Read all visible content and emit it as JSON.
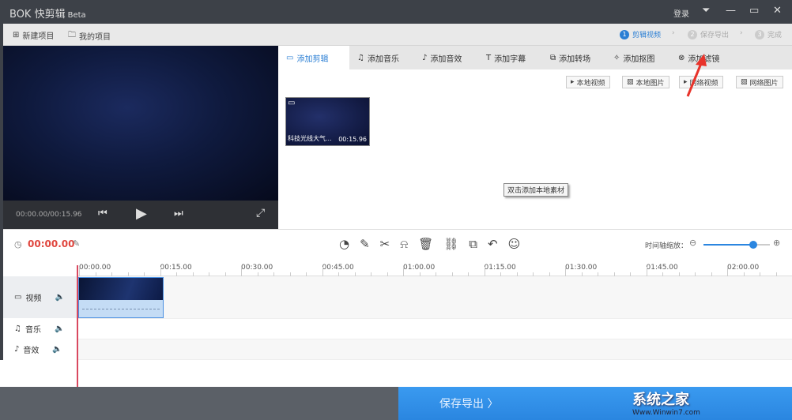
{
  "app": {
    "logo": "BOK",
    "title": "快剪辑",
    "edition": "Beta"
  },
  "window": {
    "login": "登录",
    "menu_icon": "menu-down-icon",
    "minimize_icon": "minimize-icon",
    "maximize_icon": "maximize-icon",
    "close_icon": "close-icon"
  },
  "toolbar": {
    "new_project": "新建项目",
    "my_projects": "我的项目"
  },
  "steps": [
    {
      "num": "1",
      "label": "剪辑视频",
      "active": true
    },
    {
      "num": "2",
      "label": "保存导出"
    },
    {
      "num": "3",
      "label": "完成"
    }
  ],
  "player": {
    "time": "00:00.00/00:15.96"
  },
  "tabs": [
    {
      "label": "添加剪辑",
      "icon": "video-icon",
      "active": true
    },
    {
      "label": "添加音乐",
      "icon": "music-icon"
    },
    {
      "label": "添加音效",
      "icon": "sound-effect-icon"
    },
    {
      "label": "添加字幕",
      "icon": "text-icon"
    },
    {
      "label": "添加转场",
      "icon": "transition-icon"
    },
    {
      "label": "添加抠图",
      "icon": "cutout-icon"
    },
    {
      "label": "添加滤镜",
      "icon": "filter-icon"
    }
  ],
  "sources": [
    "本地视频",
    "本地图片",
    "网络视频",
    "网络图片"
  ],
  "media": [
    {
      "name": "科技光线大气...",
      "duration": "00:15.96"
    }
  ],
  "tooltip": "双击添加本地素材",
  "timeline": {
    "current": "00:00.00",
    "zoom_label": "时间轴缩放：",
    "zoom_level": 0.75,
    "ticks": [
      "00:00.00",
      "00:15.00",
      "00:30.00",
      "00:45.00",
      "01:00.00",
      "01:15.00",
      "01:30.00",
      "01:45.00",
      "02:00.00"
    ],
    "tracks": [
      {
        "label": "视频",
        "icon": "video-icon"
      },
      {
        "label": "音乐",
        "icon": "music-icon"
      },
      {
        "label": "音效",
        "icon": "sound-effect-icon"
      }
    ]
  },
  "export": "保存导出 〉",
  "watermark": {
    "text": "系统之家",
    "url": "Www.Winwin7.com"
  },
  "colors": {
    "accent": "#2b7fd4",
    "time": "#e0463e",
    "export": "#2a86e0"
  }
}
